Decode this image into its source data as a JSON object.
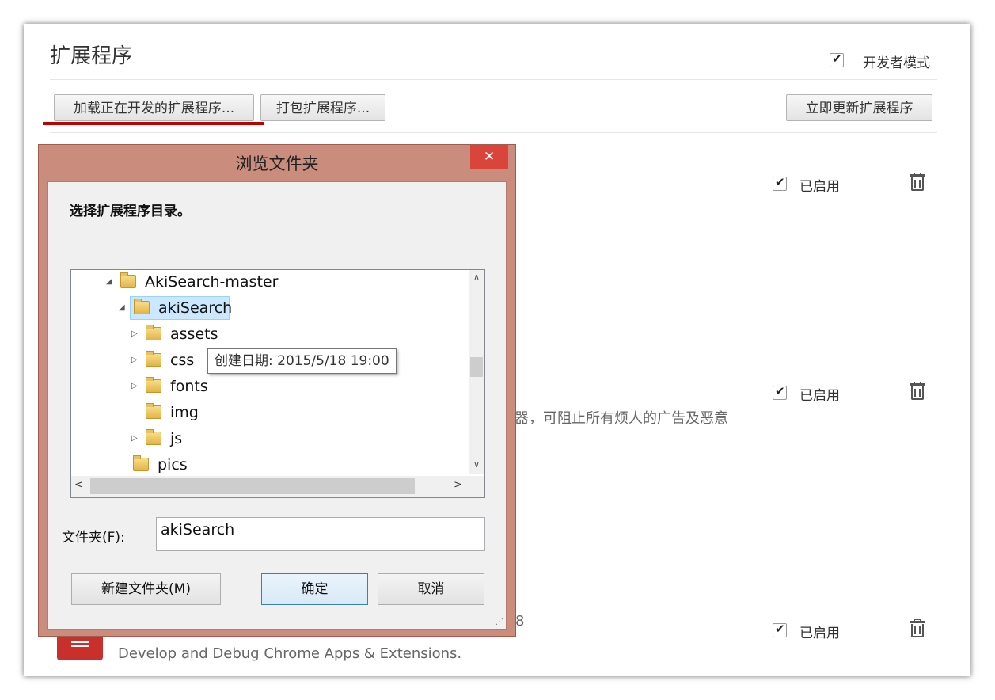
{
  "page": {
    "title": "扩展程序",
    "dev_mode_label": "开发者模式",
    "load_unpacked_label": "加载正在开发的扩展程序...",
    "pack_label": "打包扩展程序...",
    "update_label": "立即更新扩展程序"
  },
  "extensions": [
    {
      "enabled_label": "已启用"
    },
    {
      "enabled_label": "已启用",
      "desc_fragment": "器，可阻止所有烦人的广告及恶意"
    },
    {
      "enabled_label": "已启用",
      "version_fragment": "8",
      "desc": "Develop and Debug Chrome Apps & Extensions."
    }
  ],
  "dialog": {
    "title": "浏览文件夹",
    "close_glyph": "✕",
    "instruction": "选择扩展程序目录。",
    "tree": [
      {
        "name": "AkiSearch-master",
        "expander": "◢"
      },
      {
        "name": "akiSearch",
        "expander": "◢"
      },
      {
        "name": "assets",
        "expander": "▷"
      },
      {
        "name": "css",
        "expander": "▷"
      },
      {
        "name": "fonts",
        "expander": "▷"
      },
      {
        "name": "img",
        "expander": ""
      },
      {
        "name": "js",
        "expander": "▷"
      },
      {
        "name": "pics",
        "expander": ""
      }
    ],
    "tooltip": "创建日期: 2015/5/18 19:00",
    "folder_label": "文件夹(F):",
    "folder_value": "akiSearch",
    "new_folder_label": "新建文件夹(M)",
    "ok_label": "确定",
    "cancel_label": "取消"
  },
  "icons": {
    "checkmark": "✔",
    "scroll_up": "∧",
    "scroll_down": "∨",
    "scroll_left": "<",
    "scroll_right": ">",
    "grip": "⋰"
  },
  "colors": {
    "dialog_frame": "#c98c7d",
    "close_button": "#d9453b",
    "underline": "#c00000",
    "selection": "#cce8ff"
  }
}
